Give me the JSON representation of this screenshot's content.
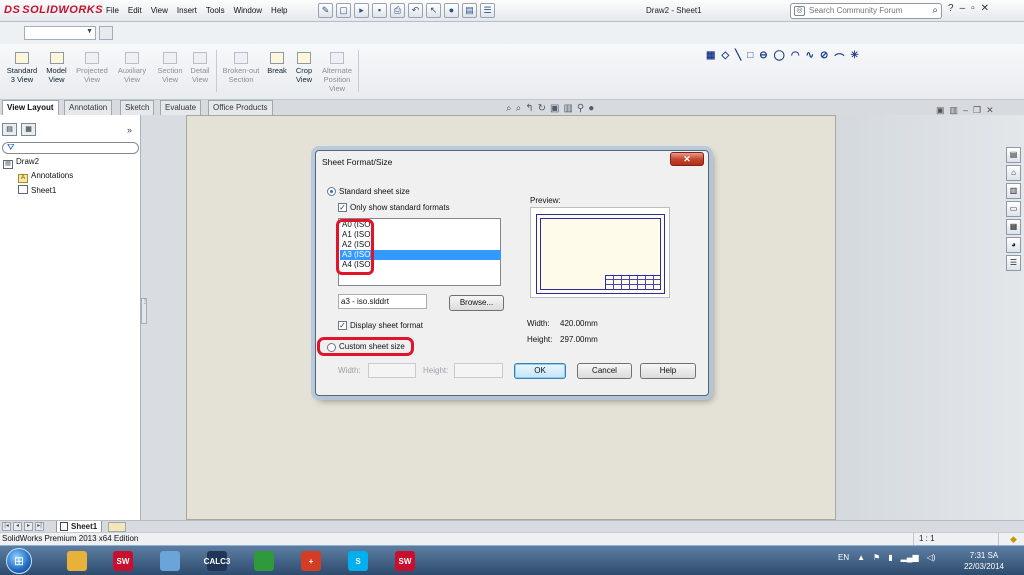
{
  "titlebar": {
    "logo_text": "SOLIDWORKS",
    "logo_mark": "DS",
    "menu": [
      "File",
      "Edit",
      "View",
      "Insert",
      "Tools",
      "Window",
      "Help"
    ],
    "document_title": "Draw2 - Sheet1",
    "search_placeholder": "Search Community Forum",
    "help_symbol": "?"
  },
  "command_manager": {
    "items": [
      {
        "label": "Standard\n3 View",
        "enabled": true
      },
      {
        "label": "Model\nView",
        "enabled": true
      },
      {
        "label": "Projected\nView",
        "enabled": false
      },
      {
        "label": "Auxiliary\nView",
        "enabled": false
      },
      {
        "label": "Section\nView",
        "enabled": false
      },
      {
        "label": "Detail\nView",
        "enabled": false
      },
      {
        "label": "Broken-out\nSection",
        "enabled": false
      },
      {
        "label": "Break",
        "enabled": true
      },
      {
        "label": "Crop\nView",
        "enabled": true
      },
      {
        "label": "Alternate\nPosition\nView",
        "enabled": false
      }
    ]
  },
  "tabs": [
    "View Layout",
    "Annotation",
    "Sketch",
    "Evaluate",
    "Office Products"
  ],
  "tree": {
    "root": "Draw2",
    "children": [
      "Annotations",
      "Sheet1"
    ]
  },
  "sheet_tabs": {
    "active": "Sheet1"
  },
  "status": {
    "edition": "SolidWorks Premium 2013 x64 Edition",
    "scale": "1 : 1"
  },
  "dialog": {
    "title": "Sheet Format/Size",
    "standard_label": "Standard sheet size",
    "only_standard_label": "Only show standard formats",
    "formats": [
      "A0 (ISO)",
      "A1 (ISO)",
      "A2 (ISO)",
      "A3 (ISO)",
      "A4 (ISO)"
    ],
    "selected_format": "A3 (ISO)",
    "format_file": "a3 - iso.slddrt",
    "browse_label": "Browse...",
    "display_format_label": "Display sheet format",
    "custom_label": "Custom sheet size",
    "custom_width_label": "Width:",
    "custom_height_label": "Height:",
    "preview_label": "Preview:",
    "width_label": "Width:",
    "width_value": "420.00mm",
    "height_label": "Height:",
    "height_value": "297.00mm",
    "ok_label": "OK",
    "cancel_label": "Cancel",
    "help_label": "Help",
    "close_symbol": "✕"
  },
  "taskbar": {
    "tray_lang": "EN",
    "time": "7:31 SA",
    "date": "22/03/2014",
    "apps": [
      {
        "name": "file-explorer",
        "label": "",
        "color": "#e8b23a"
      },
      {
        "name": "solidworks",
        "label": "SW",
        "color": "#c8102e"
      },
      {
        "name": "paint",
        "label": "",
        "color": "#6aa4d8"
      },
      {
        "name": "calculator",
        "label": "CALC3",
        "color": "#1f3658"
      },
      {
        "name": "chrome",
        "label": "",
        "color": "#2e9a3c"
      },
      {
        "name": "antivirus",
        "label": "+",
        "color": "#d43d23"
      },
      {
        "name": "skype",
        "label": "S",
        "color": "#00aff0"
      },
      {
        "name": "solidworks-2",
        "label": "SW",
        "color": "#c8102e"
      }
    ]
  }
}
